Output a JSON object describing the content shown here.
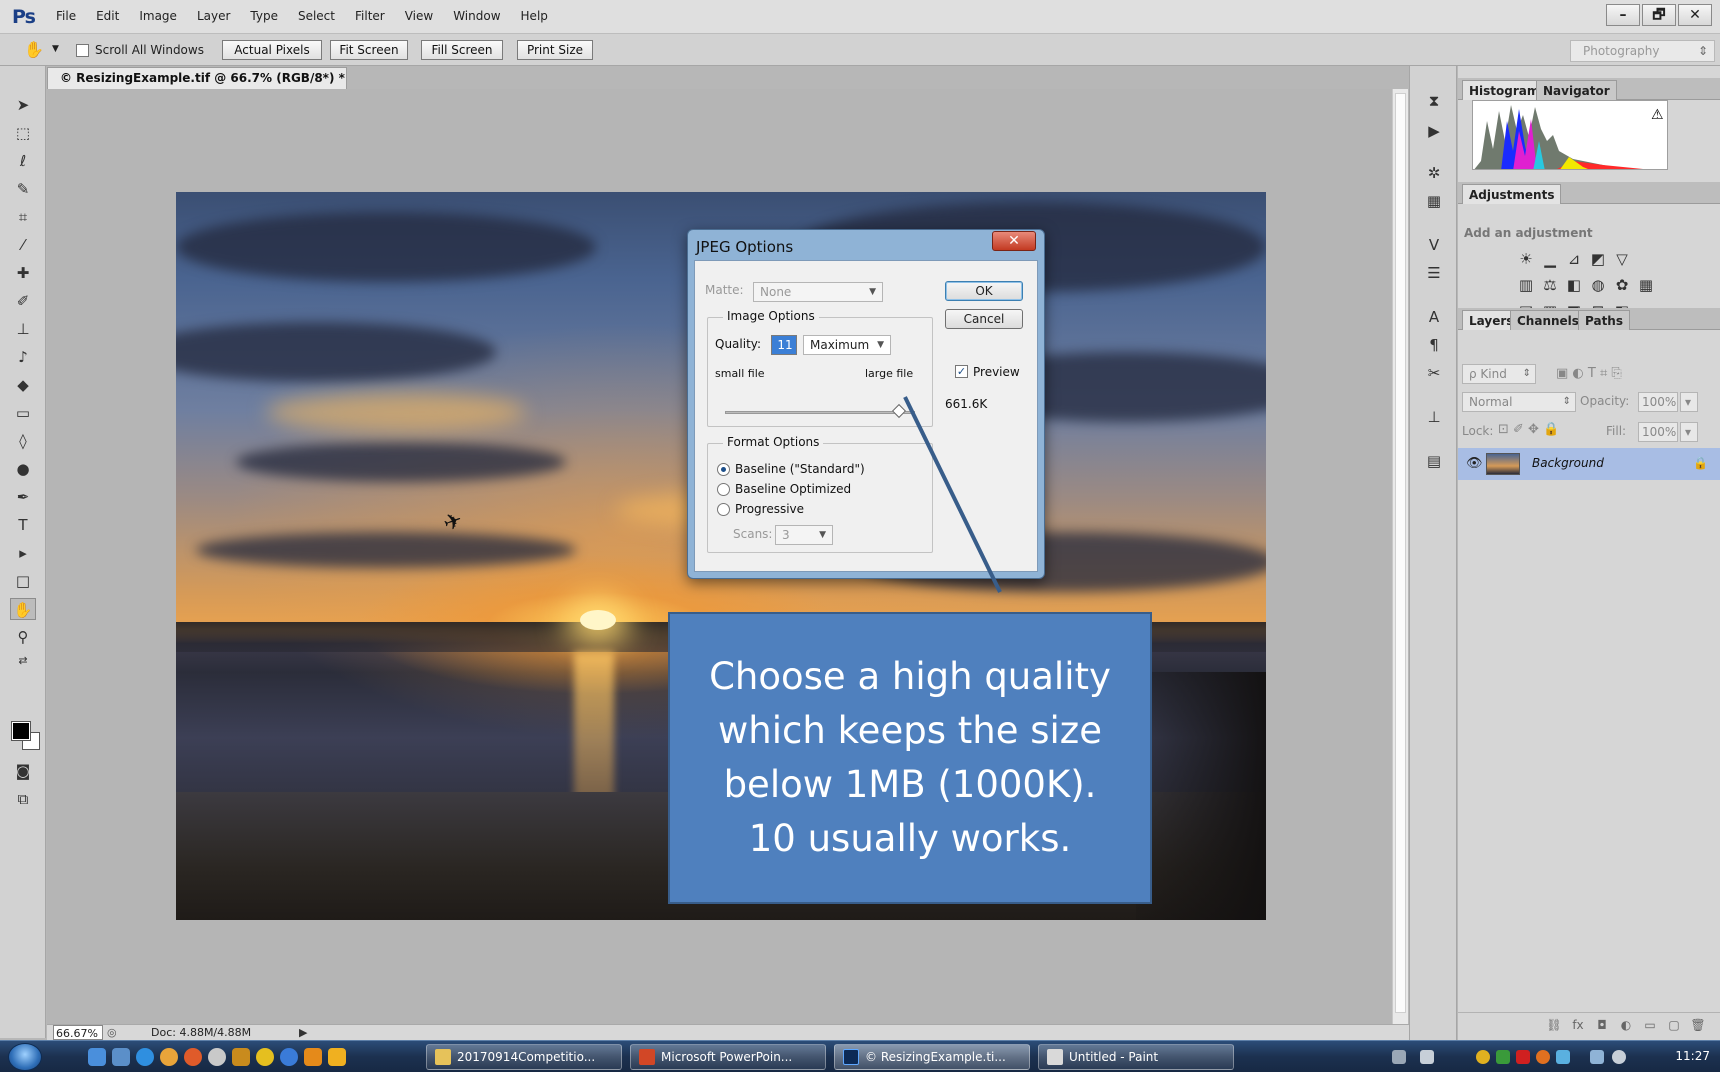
{
  "app": {
    "logo": "Ps",
    "menu": [
      "File",
      "Edit",
      "Image",
      "Layer",
      "Type",
      "Select",
      "Filter",
      "View",
      "Window",
      "Help"
    ],
    "window_controls": {
      "minimize": "–",
      "restore": "🗗",
      "close": "✕"
    }
  },
  "options_bar": {
    "scroll_all_windows": "Scroll All Windows",
    "actual_pixels": "Actual Pixels",
    "fit_screen": "Fit Screen",
    "fill_screen": "Fill Screen",
    "print_size": "Print Size",
    "workspace": "Photography"
  },
  "document": {
    "tab_title": "© ResizingExample.tif @ 66.7% (RGB/8*) *",
    "tab_close": "×"
  },
  "jpeg_dialog": {
    "title": "JPEG Options",
    "close": "✕",
    "matte_label": "Matte:",
    "matte_value": "None",
    "ok": "OK",
    "cancel": "Cancel",
    "preview_label": "Preview",
    "preview_checked": true,
    "image_options_label": "Image Options",
    "quality_label": "Quality:",
    "quality_value": "11",
    "quality_preset": "Maximum",
    "small_file": "small file",
    "large_file": "large file",
    "quality_fraction": 0.917,
    "file_size": "661.6K",
    "format_options_label": "Format Options",
    "format_baseline": "Baseline (\"Standard\")",
    "format_baseline_optimized": "Baseline Optimized",
    "format_progressive": "Progressive",
    "scans_label": "Scans:",
    "scans_value": "3"
  },
  "callout": {
    "text": "Choose a high quality which keeps the size below 1MB (1000K). 10 usually works."
  },
  "status_bar": {
    "zoom": "66.67%",
    "doc_size": "Doc: 4.88M/4.88M"
  },
  "panels": {
    "histogram_tab": "Histogram",
    "navigator_tab": "Navigator",
    "adjustments_tab": "Adjustments",
    "adjustments_hint": "Add an adjustment",
    "layers_tab": "Layers",
    "channels_tab": "Channels",
    "paths_tab": "Paths",
    "kind_label": "ρ Kind",
    "blend_mode": "Normal",
    "opacity_label": "Opacity:",
    "opacity_value": "100%",
    "lock_label": "Lock:",
    "fill_label": "Fill:",
    "fill_value": "100%",
    "layer_name": "Background"
  },
  "taskbar": {
    "tasks": [
      "20170914Competitio...",
      "Microsoft PowerPoin...",
      "© ResizingExample.ti...",
      "Untitled - Paint"
    ],
    "clock": "11:27"
  },
  "colors": {
    "callout_bg": "#4f80be",
    "layer_selected": "#a8bde4",
    "dialog_frame": "#8fb3d6"
  }
}
